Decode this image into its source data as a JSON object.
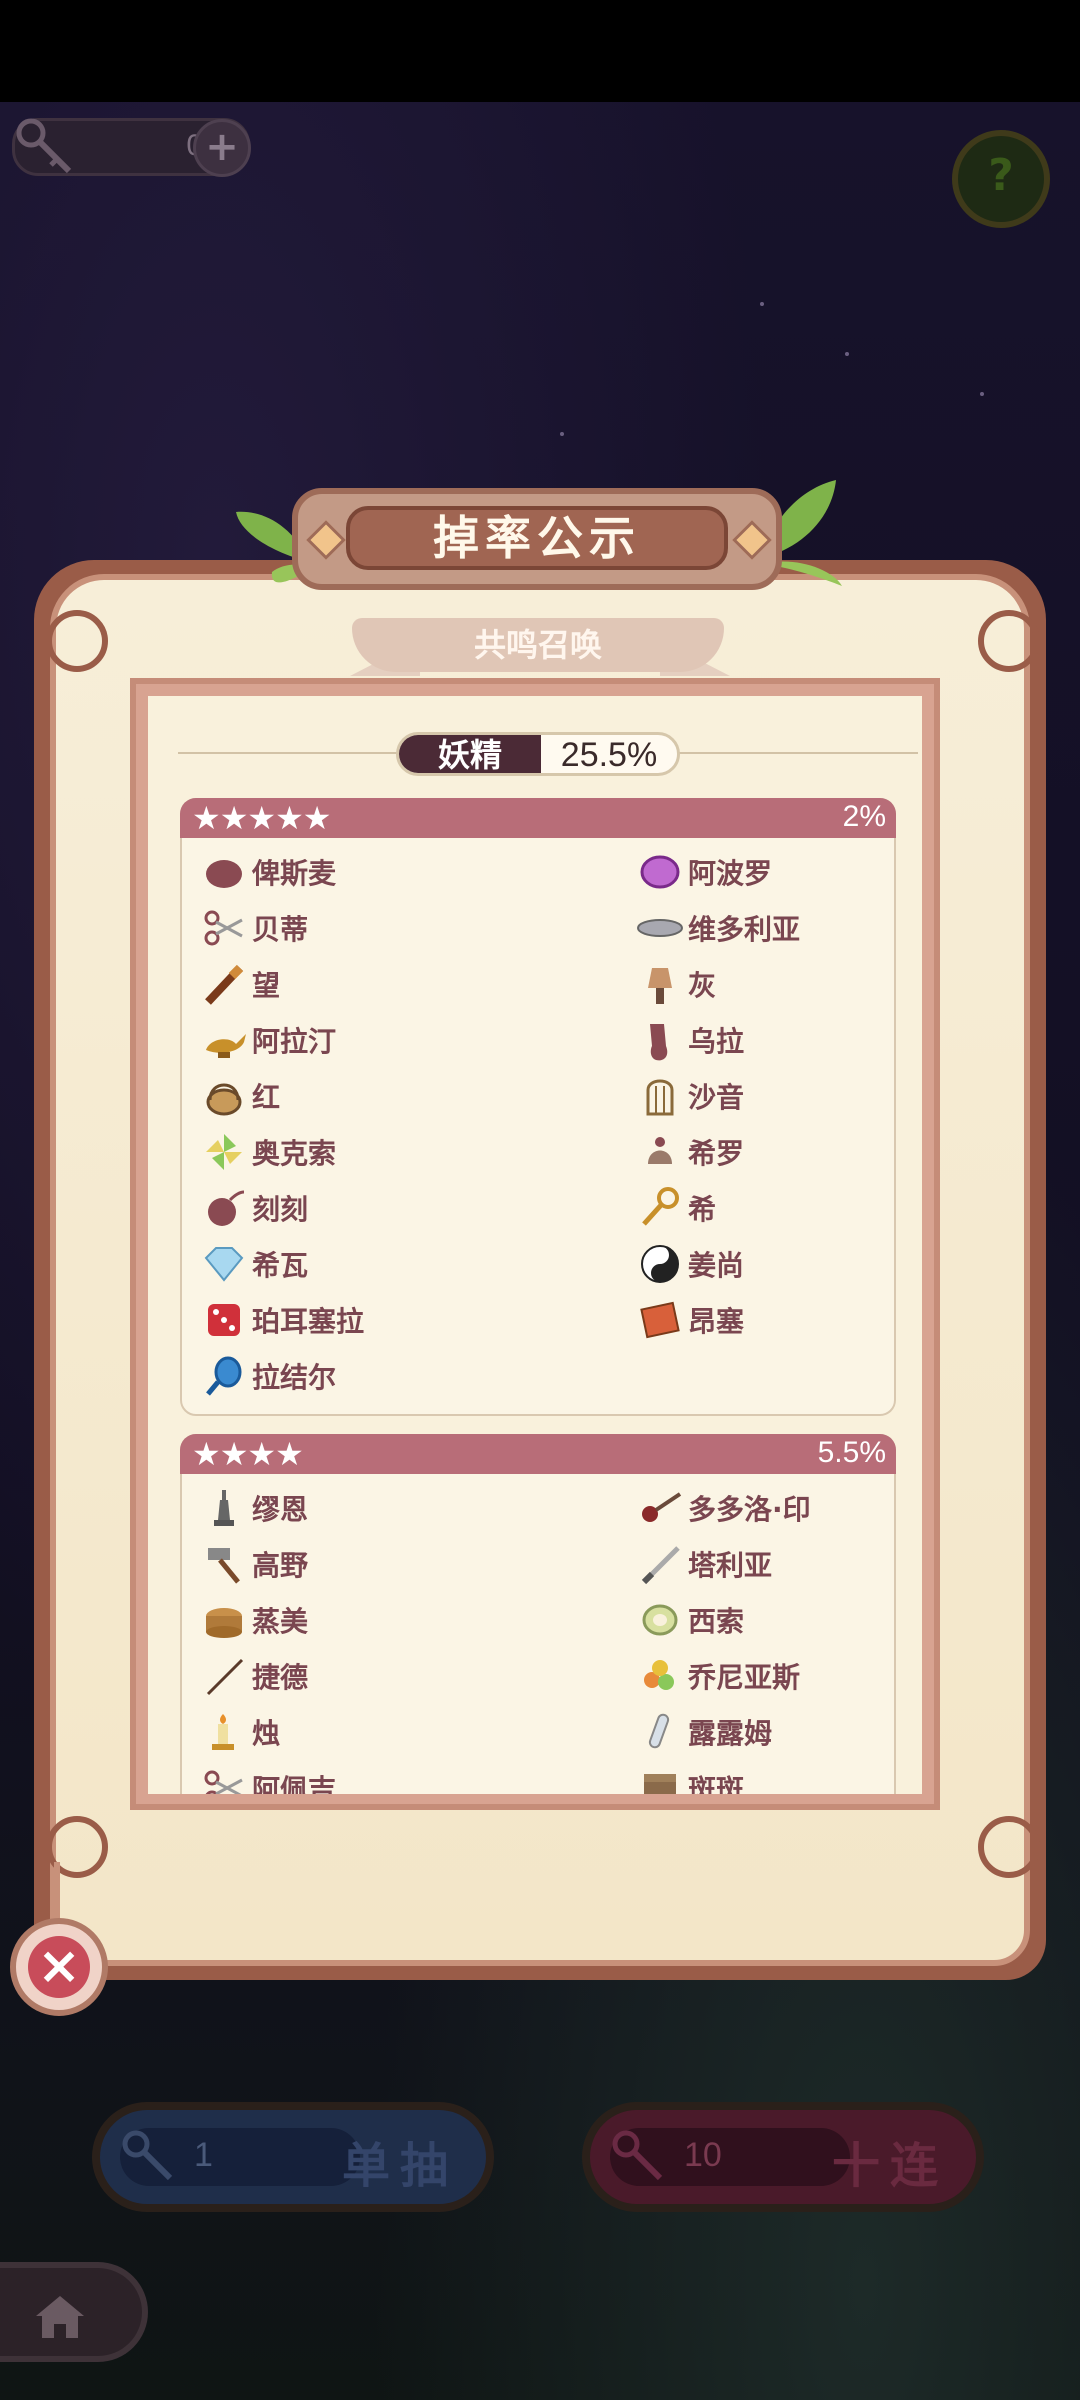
{
  "key_counter": {
    "value": "0",
    "plus_icon": "plus-icon"
  },
  "help": {
    "label": "?"
  },
  "dialog": {
    "title": "掉率公示",
    "subtitle": "共鸣召唤",
    "category": {
      "name": "妖精",
      "rate": "25.5%"
    },
    "tiers": [
      {
        "stars": "★★★★★",
        "rate": "2%",
        "items": [
          {
            "name": "俾斯麦",
            "icon": "stone-icon"
          },
          {
            "name": "阿波罗",
            "icon": "purple-disc-icon"
          },
          {
            "name": "贝蒂",
            "icon": "scissors-icon"
          },
          {
            "name": "维多利亚",
            "icon": "plate-icon"
          },
          {
            "name": "望",
            "icon": "telescope-icon"
          },
          {
            "name": "灰",
            "icon": "brush-icon"
          },
          {
            "name": "阿拉汀",
            "icon": "magic-lamp-icon"
          },
          {
            "name": "乌拉",
            "icon": "glove-icon"
          },
          {
            "name": "红",
            "icon": "basket-icon"
          },
          {
            "name": "沙音",
            "icon": "birdcage-icon"
          },
          {
            "name": "奥克索",
            "icon": "pinwheel-icon"
          },
          {
            "name": "希罗",
            "icon": "bell-icon"
          },
          {
            "name": "刻刻",
            "icon": "bomb-icon"
          },
          {
            "name": "希",
            "icon": "key-icon"
          },
          {
            "name": "希瓦",
            "icon": "diamond-icon"
          },
          {
            "name": "姜尚",
            "icon": "yin-yang-icon"
          },
          {
            "name": "珀耳塞拉",
            "icon": "dice-icon"
          },
          {
            "name": "昂塞",
            "icon": "book-icon"
          },
          {
            "name": "拉结尔",
            "icon": "mirror-icon"
          }
        ]
      },
      {
        "stars": "★★★★",
        "rate": "5.5%",
        "items": [
          {
            "name": "缪恩",
            "icon": "chess-king-icon"
          },
          {
            "name": "多多洛·印",
            "icon": "pipe-icon"
          },
          {
            "name": "高野",
            "icon": "hammer-icon"
          },
          {
            "name": "塔利亚",
            "icon": "knife-icon"
          },
          {
            "name": "蒸美",
            "icon": "steamer-icon"
          },
          {
            "name": "西索",
            "icon": "tape-icon"
          },
          {
            "name": "捷德",
            "icon": "needle-icon"
          },
          {
            "name": "乔尼亚斯",
            "icon": "candy-icon"
          },
          {
            "name": "烛",
            "icon": "candle-icon"
          },
          {
            "name": "露露姆",
            "icon": "test-tube-icon"
          },
          {
            "name": "阿佩吉",
            "icon": "scissors-icon"
          },
          {
            "name": "斑斑",
            "icon": "box-icon"
          }
        ]
      }
    ]
  },
  "close": {
    "label": "×"
  },
  "draw_single": {
    "count": "1",
    "label": "单抽"
  },
  "draw_ten": {
    "count": "10",
    "label": "十连"
  },
  "home": {
    "icon": "home-icon"
  }
}
